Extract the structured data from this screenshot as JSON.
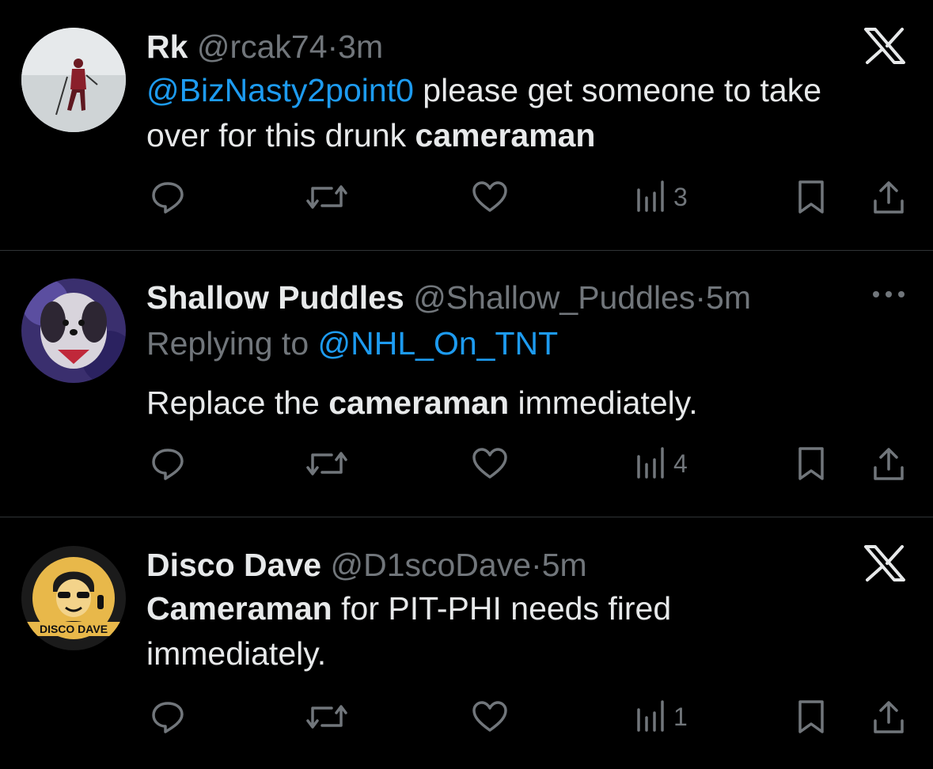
{
  "colors": {
    "background": "#000000",
    "text": "#e7e9ea",
    "secondary": "#71767b",
    "link": "#1d9bf0",
    "divider": "#2f3336"
  },
  "tweets": [
    {
      "name": "Rk",
      "handle": "@rcak74",
      "dot": "·",
      "time": "3m",
      "corner_icon": "x-logo-icon",
      "body": {
        "mention": "@BizNasty2point0",
        "text_a": " please get someone to take\nover for this drunk ",
        "bold": "cameraman",
        "text_b": ""
      },
      "views": "3"
    },
    {
      "name": "Shallow Puddles",
      "handle": "@Shallow_Puddles",
      "dot": "·",
      "time": "5m",
      "corner_icon": "more-icon",
      "replying_prefix": "Replying to ",
      "replying_mention": "@NHL_On_TNT",
      "body": {
        "text_a": "Replace the ",
        "bold": "cameraman",
        "text_b": " immediately."
      },
      "views": "4"
    },
    {
      "name": "Disco Dave",
      "handle": "@D1scoDave",
      "dot": "·",
      "time": "5m",
      "corner_icon": "x-logo-icon",
      "avatar_text": "DISCO DAVE",
      "body": {
        "bold": "Cameraman",
        "text_b": " for PIT-PHI needs fired\nimmediately."
      },
      "views": "1"
    }
  ]
}
